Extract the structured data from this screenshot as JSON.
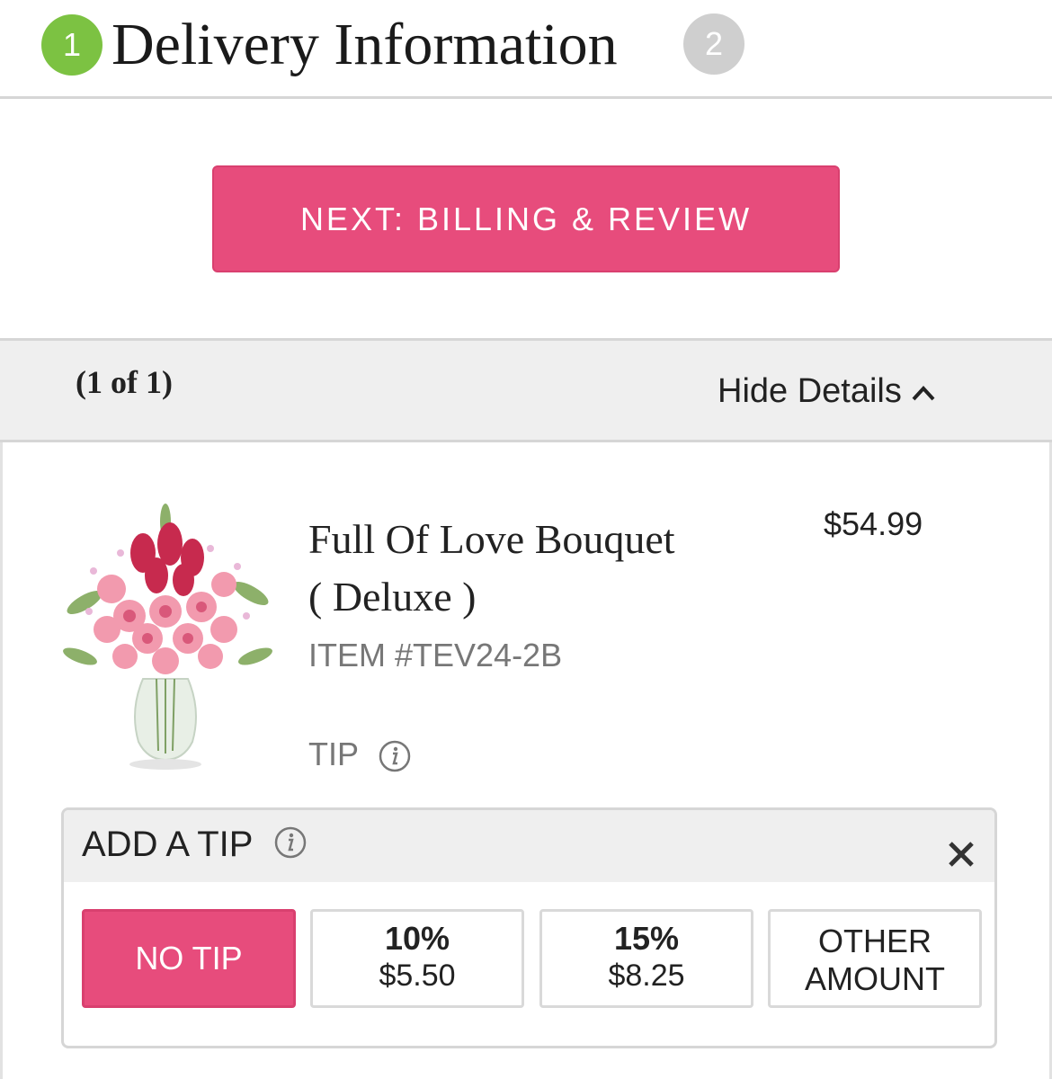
{
  "header": {
    "step1_number": "1",
    "step1_title": "Delivery Information",
    "step2_number": "2",
    "accent_green": "#7cc242",
    "inactive_gray": "#cfcfcf"
  },
  "next_button": {
    "label": "NEXT: BILLING & REVIEW",
    "color": "#e74c7c"
  },
  "order_panel": {
    "count": "(1 of 1)",
    "toggle_label": "Hide Details",
    "toggle_icon": "chevron-up-icon"
  },
  "product": {
    "name_line1": "Full Of Love Bouquet",
    "name_line2": "( Deluxe )",
    "item_number": "ITEM #TEV24-2B",
    "price": "$54.99",
    "tip_label": "TIP",
    "image_icon": "flower-bouquet-image"
  },
  "tip_box": {
    "title": "ADD A TIP",
    "options": [
      {
        "label": "NO TIP",
        "selected": true
      },
      {
        "percent": "10%",
        "amount": "$5.50",
        "selected": false
      },
      {
        "percent": "15%",
        "amount": "$8.25",
        "selected": false
      },
      {
        "line1": "OTHER",
        "line2": "AMOUNT",
        "selected": false
      }
    ]
  }
}
